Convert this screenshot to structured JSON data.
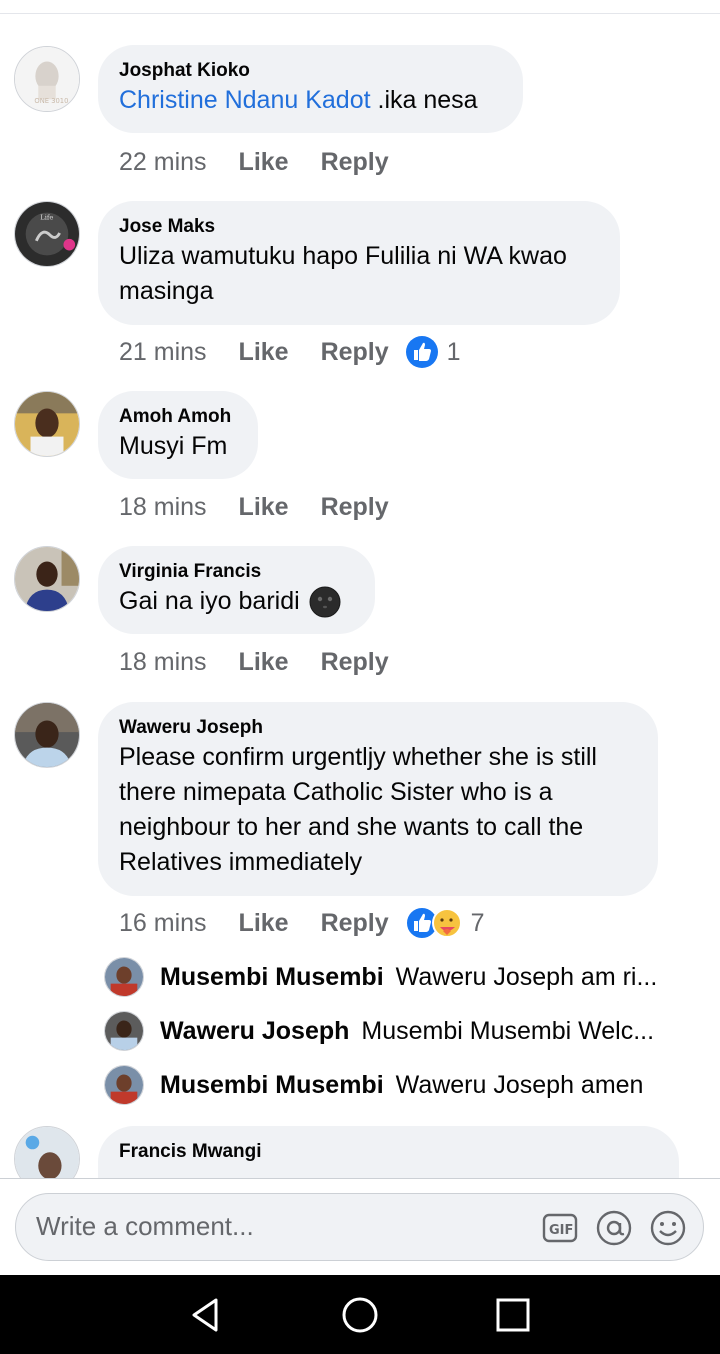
{
  "comments": [
    {
      "author": "Josphat Kioko",
      "mention": "Christine Ndanu Kadot",
      "text": " .ika nesa",
      "time": "22 mins",
      "like": "Like",
      "reply": "Reply"
    },
    {
      "author": "Jose Maks",
      "text": "Uliza wamutuku hapo Fulilia ni WA kwao masinga",
      "time": "21 mins",
      "like": "Like",
      "reply": "Reply",
      "reaction_count": "1"
    },
    {
      "author": "Amoh Amoh",
      "text": "Musyi Fm",
      "time": "18 mins",
      "like": "Like",
      "reply": "Reply"
    },
    {
      "author": "Virginia Francis",
      "text": "Gai na iyo baridi",
      "time": "18 mins",
      "like": "Like",
      "reply": "Reply"
    },
    {
      "author": "Waweru Joseph",
      "text": "Please confirm urgentljy whether she is still there nimepata Catholic Sister who is a neighbour to her and she wants to call the Relatives immediately",
      "time": "16 mins",
      "like": "Like",
      "reply": "Reply",
      "reaction_count": "7",
      "replies": [
        {
          "author": "Musembi Musembi",
          "text": "Waweru Joseph am ri..."
        },
        {
          "author": "Waweru Joseph",
          "text": "Musembi Musembi Welc..."
        },
        {
          "author": "Musembi Musembi",
          "text": "Waweru Joseph amen"
        }
      ]
    },
    {
      "author": "Francis Mwangi"
    }
  ],
  "composer": {
    "placeholder": "Write a comment..."
  },
  "icons": [
    "gif-icon",
    "at-mention-icon",
    "emoji-icon",
    "back-nav-icon",
    "home-nav-icon",
    "recents-nav-icon",
    "like-reaction-icon",
    "care-reaction-icon",
    "new-moon-face-emoji"
  ],
  "colors": {
    "mention": "#216fdb",
    "like_blue": "#1877f2",
    "bubble": "#f0f2f5",
    "meta": "#65676b"
  }
}
